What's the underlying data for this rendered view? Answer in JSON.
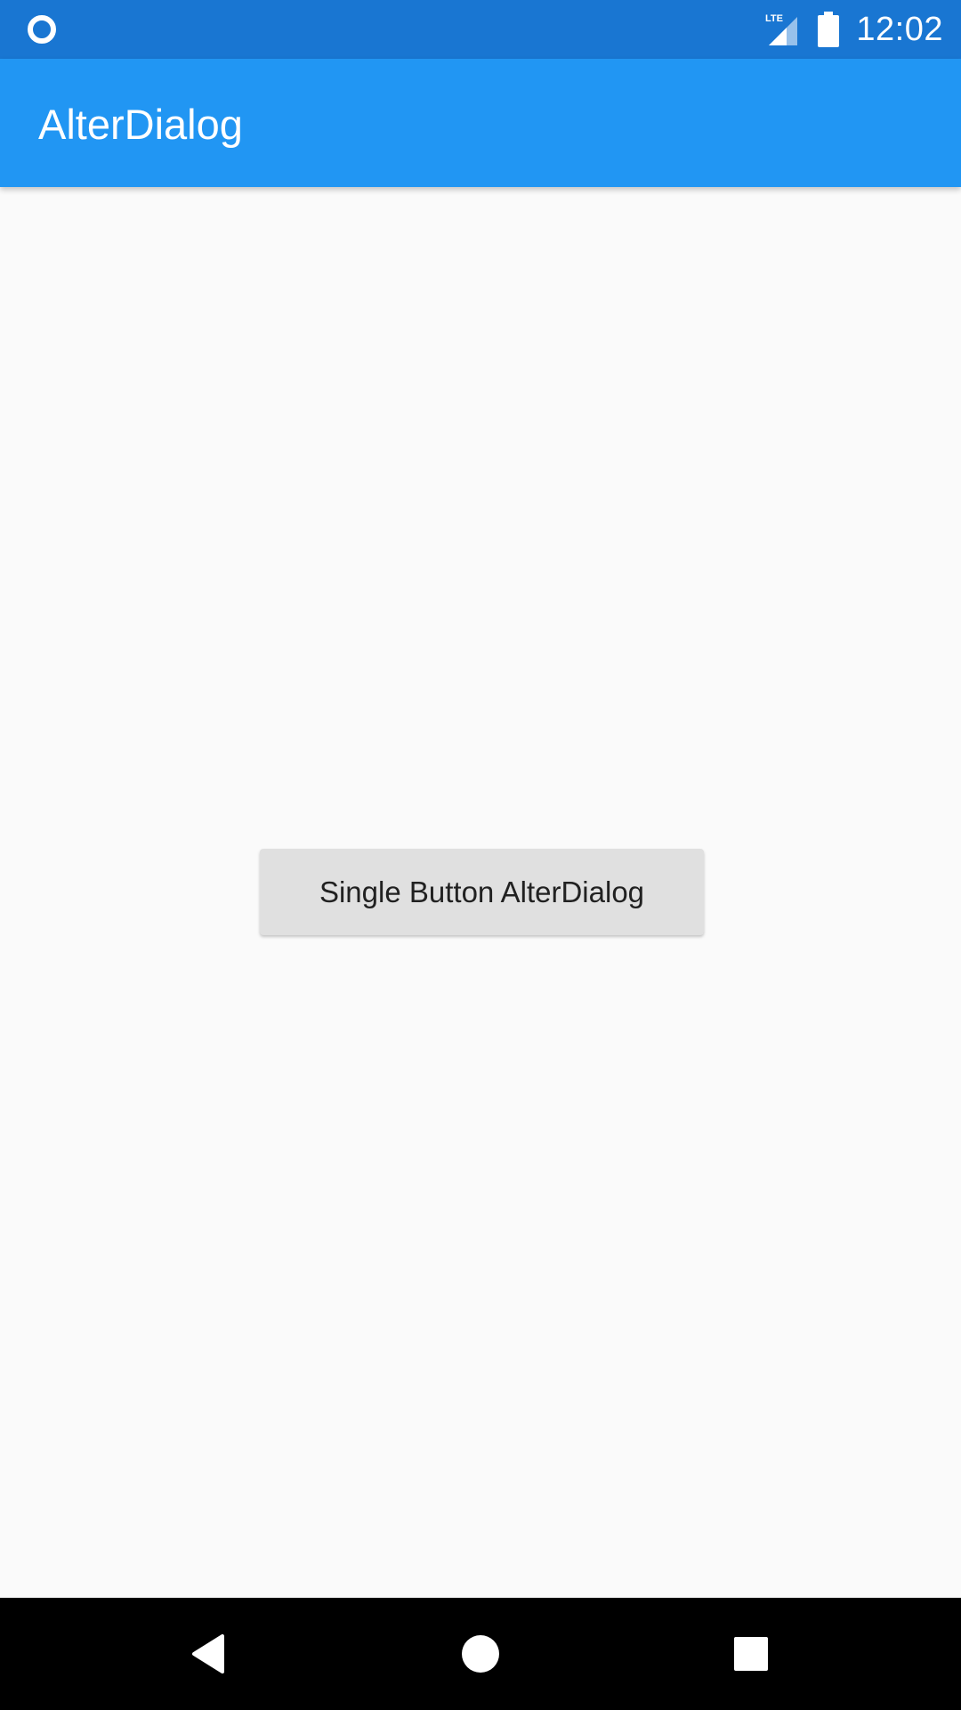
{
  "status_bar": {
    "time": "12:02",
    "network_label": "LTE",
    "icons": [
      "circle-notification-icon",
      "lte-signal-icon",
      "battery-icon"
    ],
    "color": "#1976d2"
  },
  "app_bar": {
    "title": "AlterDialog",
    "color": "#2196f3"
  },
  "main": {
    "button_label": "Single Button AlterDialog",
    "button_color": "#e0e0e0"
  },
  "nav_bar": {
    "icons": [
      "back-icon",
      "home-icon",
      "recents-icon"
    ]
  }
}
